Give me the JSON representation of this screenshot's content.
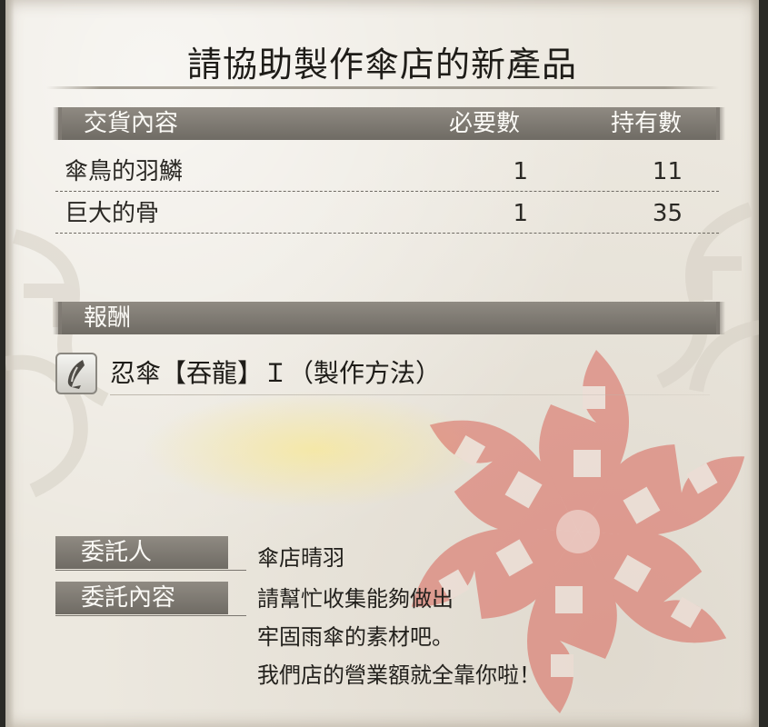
{
  "quest": {
    "title": "請協助製作傘店的新產品"
  },
  "delivery": {
    "header": {
      "content": "交貨內容",
      "required": "必要數",
      "owned": "持有數"
    },
    "items": [
      {
        "name": "傘鳥的羽鱗",
        "required": "1",
        "owned": "11"
      },
      {
        "name": "巨大的骨",
        "required": "1",
        "owned": "35"
      }
    ]
  },
  "reward": {
    "header": "報酬",
    "icon": "umbrella-weapon-icon",
    "label": "忍傘【吞龍】Ｉ（製作方法）"
  },
  "client": {
    "label": "委託人",
    "value": "傘店晴羽"
  },
  "request": {
    "label": "委託內容",
    "lines": [
      "請幫忙收集能夠做出",
      "牢固雨傘的素材吧。",
      "我們店的營業額就全靠你啦！"
    ]
  },
  "colors": {
    "parchment": "#ece8df",
    "header_bar": "#7f7a73",
    "flower": "#d9655a"
  }
}
